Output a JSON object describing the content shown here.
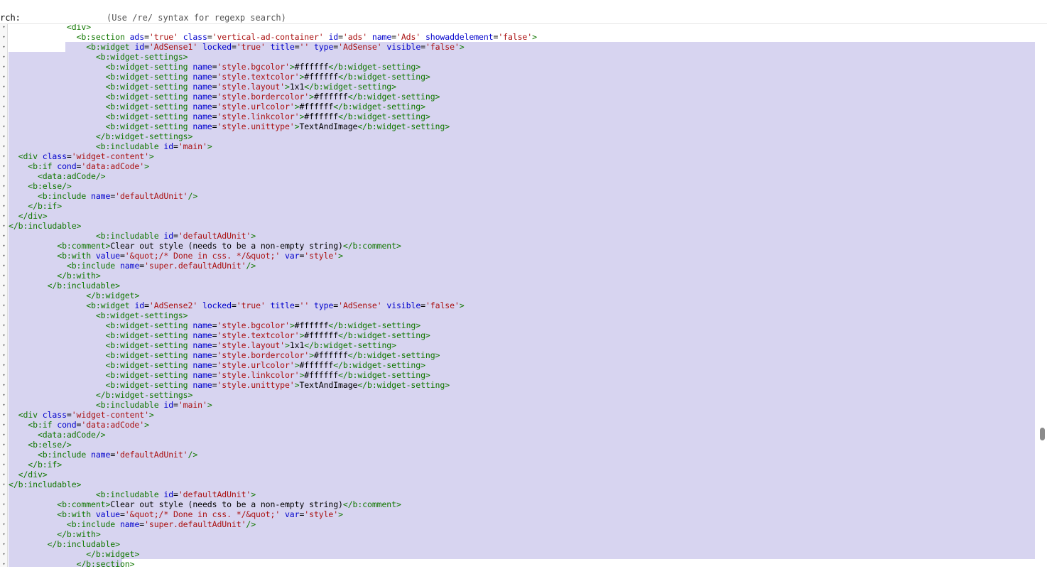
{
  "search": {
    "label": "rch:",
    "hint": "(Use /re/ syntax for regexp search)",
    "value": ""
  },
  "editor": {
    "colors": {
      "selection": "#d7d4f0",
      "tag": "#117700",
      "attribute": "#0000cc",
      "string": "#aa1111",
      "text": "#000000"
    },
    "lines": [
      "            <div>",
      "              <b:section ads='true' class='vertical-ad-container' id='ads' name='Ads' showaddelement='false'>",
      "                <b:widget id='AdSense1' locked='true' title='' type='AdSense' visible='false'>",
      "                  <b:widget-settings>",
      "                    <b:widget-setting name='style.bgcolor'>#ffffff</b:widget-setting>",
      "                    <b:widget-setting name='style.textcolor'>#ffffff</b:widget-setting>",
      "                    <b:widget-setting name='style.layout'>1x1</b:widget-setting>",
      "                    <b:widget-setting name='style.bordercolor'>#ffffff</b:widget-setting>",
      "                    <b:widget-setting name='style.urlcolor'>#ffffff</b:widget-setting>",
      "                    <b:widget-setting name='style.linkcolor'>#ffffff</b:widget-setting>",
      "                    <b:widget-setting name='style.unittype'>TextAndImage</b:widget-setting>",
      "                  </b:widget-settings>",
      "                  <b:includable id='main'>",
      "  <div class='widget-content'>",
      "    <b:if cond='data:adCode'>",
      "      <data:adCode/>",
      "    <b:else/>",
      "      <b:include name='defaultAdUnit'/>",
      "    </b:if>",
      "  </div>",
      "</b:includable>",
      "                  <b:includable id='defaultAdUnit'>",
      "          <b:comment>Clear out style (needs to be a non-empty string)</b:comment>",
      "          <b:with value='&quot;/* Done in css. */&quot;' var='style'>",
      "            <b:include name='super.defaultAdUnit'/>",
      "          </b:with>",
      "        </b:includable>",
      "                </b:widget>",
      "                <b:widget id='AdSense2' locked='true' title='' type='AdSense' visible='false'>",
      "                  <b:widget-settings>",
      "                    <b:widget-setting name='style.bgcolor'>#ffffff</b:widget-setting>",
      "                    <b:widget-setting name='style.textcolor'>#ffffff</b:widget-setting>",
      "                    <b:widget-setting name='style.layout'>1x1</b:widget-setting>",
      "                    <b:widget-setting name='style.bordercolor'>#ffffff</b:widget-setting>",
      "                    <b:widget-setting name='style.urlcolor'>#ffffff</b:widget-setting>",
      "                    <b:widget-setting name='style.linkcolor'>#ffffff</b:widget-setting>",
      "                    <b:widget-setting name='style.unittype'>TextAndImage</b:widget-setting>",
      "                  </b:widget-settings>",
      "                  <b:includable id='main'>",
      "  <div class='widget-content'>",
      "    <b:if cond='data:adCode'>",
      "      <data:adCode/>",
      "    <b:else/>",
      "      <b:include name='defaultAdUnit'/>",
      "    </b:if>",
      "  </div>",
      "</b:includable>",
      "                  <b:includable id='defaultAdUnit'>",
      "          <b:comment>Clear out style (needs to be a non-empty string)</b:comment>",
      "          <b:with value='&quot;/* Done in css. */&quot;' var='style'>",
      "            <b:include name='super.defaultAdUnit'/>",
      "          </b:with>",
      "        </b:includable>",
      "                </b:widget>",
      "              </b:section>"
    ]
  }
}
